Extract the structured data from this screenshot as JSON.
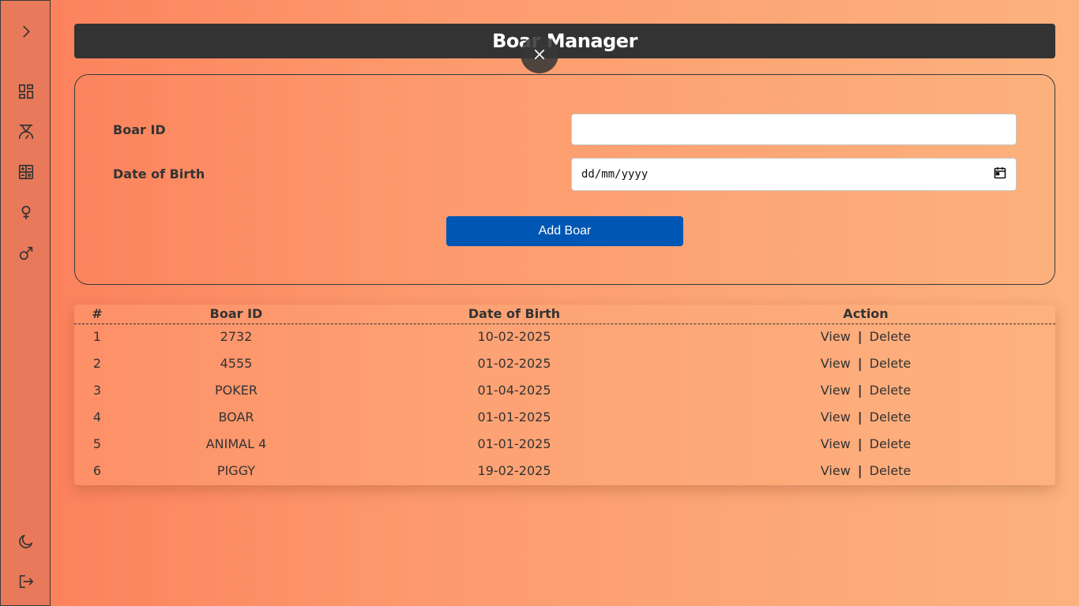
{
  "header": {
    "title": "Boar Manager"
  },
  "sidebar": {
    "items": [
      {
        "icon": "chevron-right-icon"
      },
      {
        "icon": "dashboard-icon"
      },
      {
        "icon": "scale-icon"
      },
      {
        "icon": "calculator-icon"
      },
      {
        "icon": "female-icon"
      },
      {
        "icon": "male-icon"
      },
      {
        "icon": "moon-icon"
      },
      {
        "icon": "logout-icon"
      }
    ]
  },
  "form": {
    "boar_id_label": "Boar ID",
    "boar_id_value": "",
    "dob_label": "Date of Birth",
    "dob_placeholder": "dd/mm/yyyy",
    "add_button": "Add Boar"
  },
  "table": {
    "headers": [
      "#",
      "Boar ID",
      "Date of Birth",
      "Action"
    ],
    "rows": [
      {
        "num": "1",
        "boar_id": "2732",
        "dob": "10-02-2025",
        "view": "View",
        "delete": "Delete"
      },
      {
        "num": "2",
        "boar_id": "4555",
        "dob": "01-02-2025",
        "view": "View",
        "delete": "Delete"
      },
      {
        "num": "3",
        "boar_id": "POKER",
        "dob": "01-04-2025",
        "view": "View",
        "delete": "Delete"
      },
      {
        "num": "4",
        "boar_id": "BOAR",
        "dob": "01-01-2025",
        "view": "View",
        "delete": "Delete"
      },
      {
        "num": "5",
        "boar_id": "ANIMAL 4",
        "dob": "01-01-2025",
        "view": "View",
        "delete": "Delete"
      },
      {
        "num": "6",
        "boar_id": "PIGGY",
        "dob": "19-02-2025",
        "view": "View",
        "delete": "Delete"
      }
    ],
    "separator": "|"
  },
  "colors": {
    "header_bg": "#333333",
    "button_bg": "#0056b3",
    "gradient_start": "#fc7f5a",
    "gradient_end": "#fcb27e"
  }
}
